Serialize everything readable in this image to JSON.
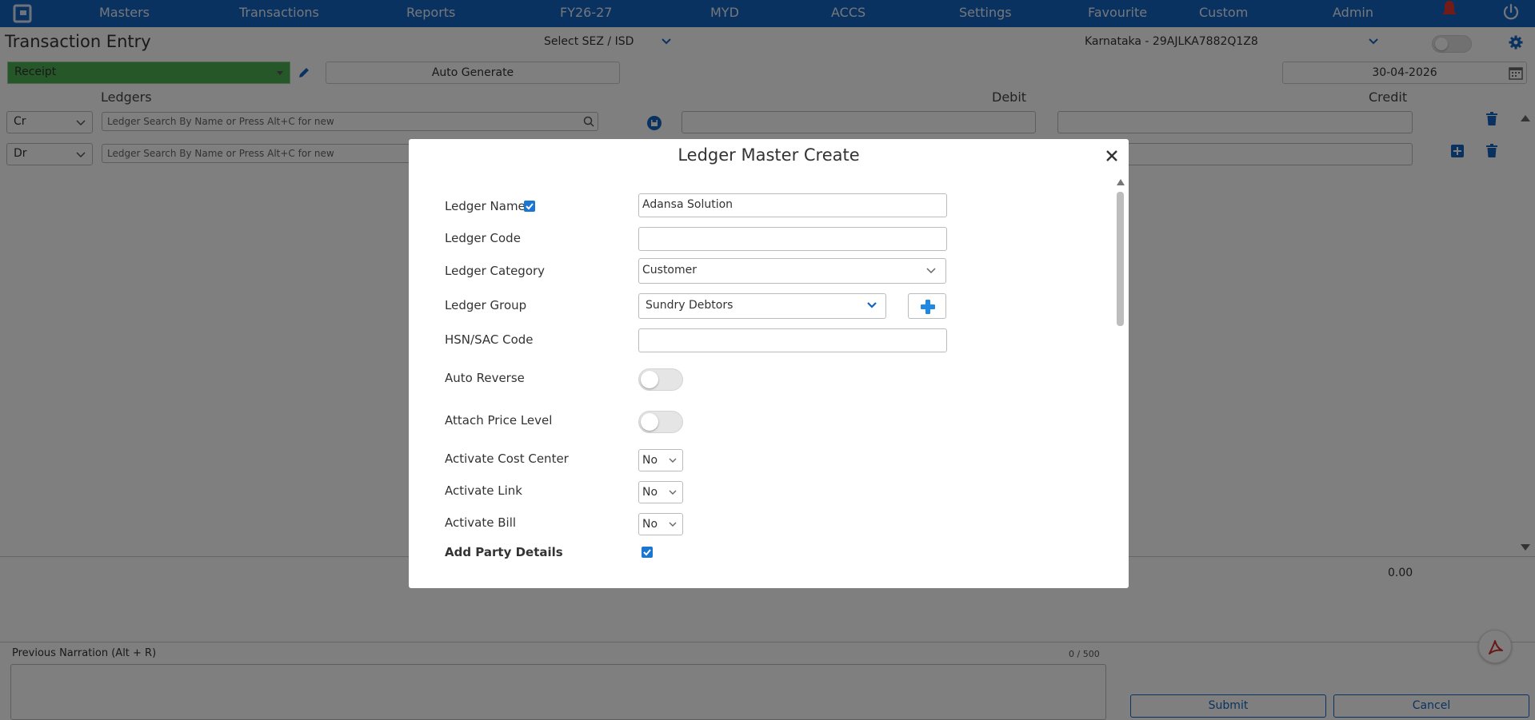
{
  "nav": {
    "items": [
      "Masters",
      "Transactions",
      "Reports",
      "FY26-27",
      "MYD",
      "ACCS",
      "Settings",
      "Favourite",
      "Custom",
      "Admin"
    ],
    "color": "#1565c0"
  },
  "header": {
    "title": "Transaction Entry",
    "sez_label": "Select SEZ / ISD",
    "gst_label": "Karnataka - 29AJLKA7882Q1Z8"
  },
  "voucher": {
    "type": "Receipt",
    "auto_generate": "Auto Generate",
    "date": "30-04-2026"
  },
  "columns": {
    "ledgers": "Ledgers",
    "debit": "Debit",
    "credit": "Credit"
  },
  "rows": [
    {
      "type": "Cr",
      "placeholder": "Ledger Search By Name or Press Alt+C for new"
    },
    {
      "type": "Dr",
      "placeholder": "Ledger Search By Name or Press Alt+C for new"
    }
  ],
  "totals": {
    "credit": "0.00"
  },
  "narration": {
    "label": "Previous Narration (Alt + R)",
    "count": "0 / 500"
  },
  "buttons": {
    "submit": "Submit",
    "cancel": "Cancel"
  },
  "modal": {
    "title": "Ledger Master Create",
    "fields": {
      "ledger_name_label": "Ledger Name",
      "ledger_name_value": "Adansa Solution",
      "ledger_code_label": "Ledger Code",
      "ledger_code_value": "",
      "ledger_category_label": "Ledger Category",
      "ledger_category_value": "Customer",
      "ledger_group_label": "Ledger Group",
      "ledger_group_value": "Sundry Debtors",
      "hsn_label": "HSN/SAC Code",
      "hsn_value": "",
      "auto_reverse_label": "Auto Reverse",
      "attach_price_label": "Attach Price Level",
      "cost_center_label": "Activate Cost Center",
      "cost_center_value": "No",
      "link_label": "Activate Link",
      "link_value": "No",
      "bill_label": "Activate Bill",
      "bill_value": "No",
      "party_details_label": "Add Party Details"
    }
  },
  "icons": {
    "logo": "logo-icon",
    "bell": "bell-icon",
    "power": "power-icon",
    "gear": "gear-icon",
    "calendar": "calendar-icon",
    "pencil": "pencil-icon",
    "search": "search-icon",
    "trash": "trash-icon",
    "plus": "plus-icon",
    "close": "close-icon",
    "pdf": "pdf-icon",
    "arrow": "down-arrow-annotation"
  }
}
